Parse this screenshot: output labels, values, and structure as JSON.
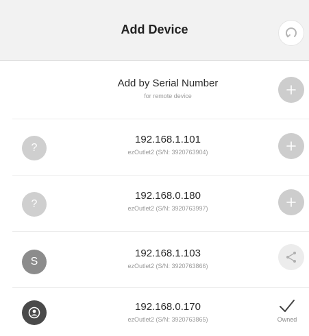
{
  "header": {
    "title": "Add Device",
    "refresh_icon": "refresh-icon"
  },
  "serial_entry": {
    "label": "Add by Serial Number",
    "sublabel": "for remote device",
    "action_icon": "plus-icon"
  },
  "devices": [
    {
      "avatar": "?",
      "ip": "192.168.1.101",
      "detail": "ezOutlet2 (S/N: 3920763904)",
      "action": "add"
    },
    {
      "avatar": "?",
      "ip": "192.168.0.180",
      "detail": "ezOutlet2 (S/N: 3920763997)",
      "action": "add"
    },
    {
      "avatar": "S",
      "ip": "192.168.1.103",
      "detail": "ezOutlet2 (S/N: 3920763866)",
      "action": "share"
    },
    {
      "avatar": "",
      "ip": "192.168.0.170",
      "detail": "ezOutlet2 (S/N: 3920763865)",
      "action": "owned",
      "action_label": "Owned"
    }
  ],
  "colors": {
    "header_bg": "#f2f2f2",
    "action_circle": "#cdcdcd",
    "avatar_dark": "#4a4a4a"
  }
}
